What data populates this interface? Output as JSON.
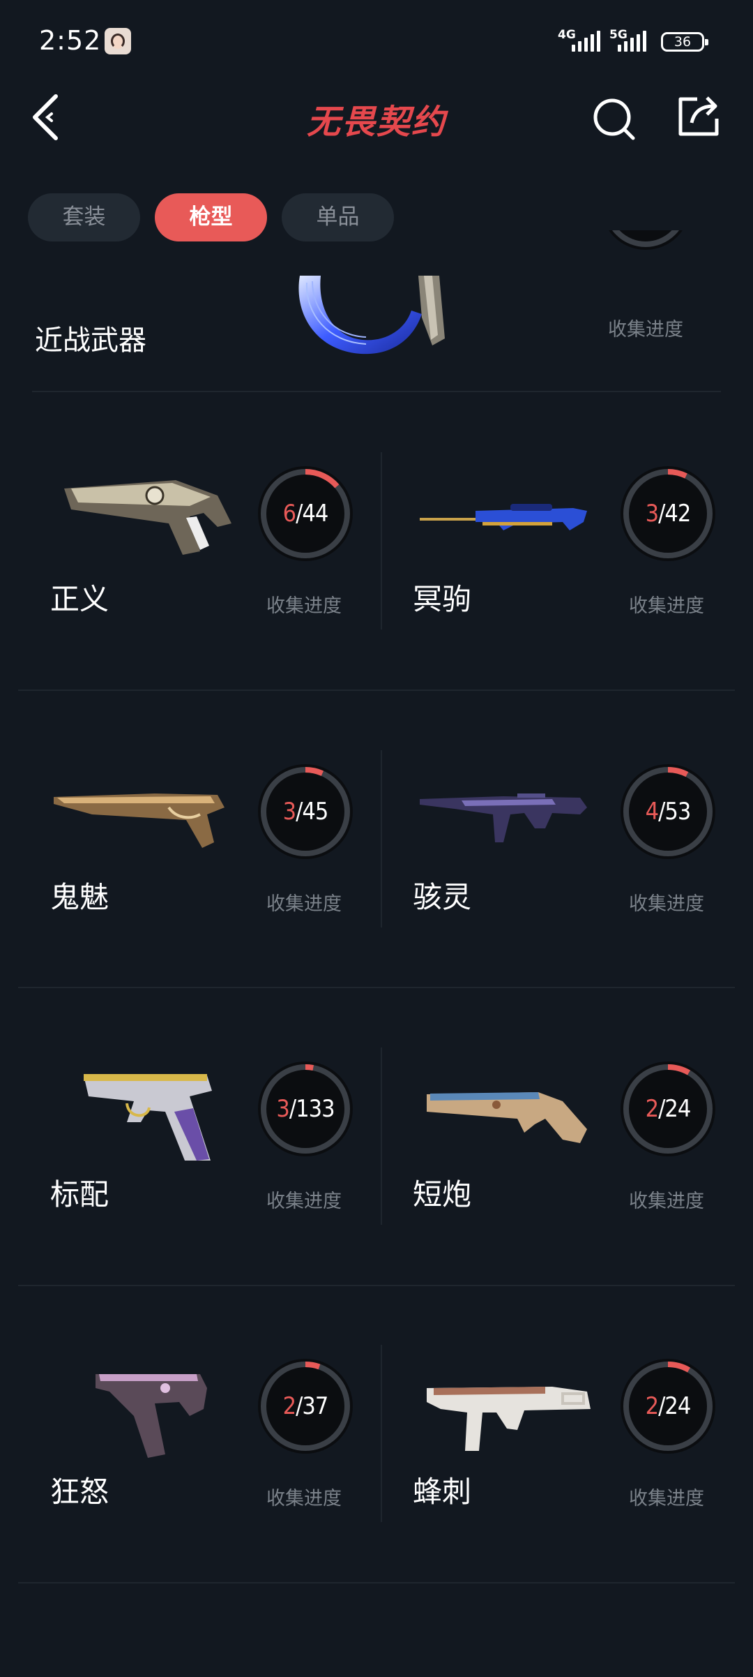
{
  "status_bar": {
    "time": "2:52",
    "network_1": "4G",
    "network_2": "5G",
    "battery": "36"
  },
  "header": {
    "title": "无畏契约"
  },
  "tabs": [
    {
      "label": "套装",
      "active": false
    },
    {
      "label": "枪型",
      "active": true
    },
    {
      "label": "单品",
      "active": false
    }
  ],
  "melee": {
    "name": "近战武器",
    "progress_label": "收集进度"
  },
  "weapons": [
    {
      "name": "正义",
      "owned": "6",
      "total": "44",
      "progress_label": "收集进度"
    },
    {
      "name": "冥驹",
      "owned": "3",
      "total": "42",
      "progress_label": "收集进度"
    },
    {
      "name": "鬼魅",
      "owned": "3",
      "total": "45",
      "progress_label": "收集进度"
    },
    {
      "name": "骇灵",
      "owned": "4",
      "total": "53",
      "progress_label": "收集进度"
    },
    {
      "name": "标配",
      "owned": "3",
      "total": "133",
      "progress_label": "收集进度"
    },
    {
      "name": "短炮",
      "owned": "2",
      "total": "24",
      "progress_label": "收集进度"
    },
    {
      "name": "狂怒",
      "owned": "2",
      "total": "37",
      "progress_label": "收集进度"
    },
    {
      "name": "蜂刺",
      "owned": "2",
      "total": "24",
      "progress_label": "收集进度"
    }
  ],
  "colors": {
    "background": "#121820",
    "accent": "#e85a58",
    "ring_track": "#3a3f46",
    "muted_text": "#7b828a"
  }
}
